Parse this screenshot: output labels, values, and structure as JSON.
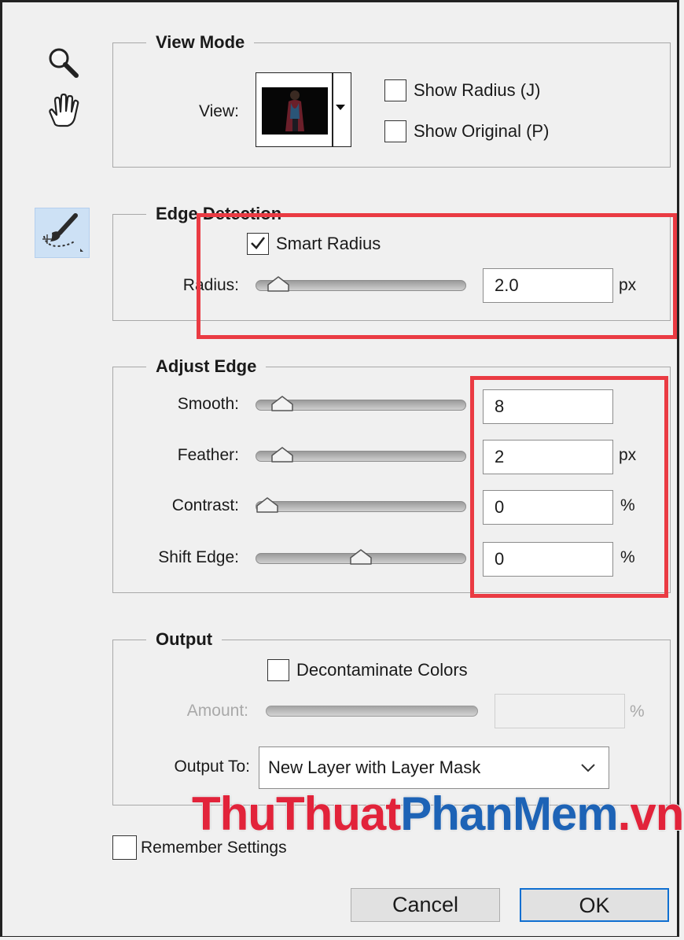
{
  "view_mode": {
    "title": "View Mode",
    "view_label": "View:",
    "show_radius": {
      "label": "Show Radius (J)",
      "checked": false
    },
    "show_original": {
      "label": "Show Original (P)",
      "checked": false
    }
  },
  "edge_detection": {
    "title": "Edge Detection",
    "smart_radius": {
      "label": "Smart Radius",
      "checked": true
    },
    "radius": {
      "label": "Radius:",
      "value": "2.0",
      "unit": "px",
      "slider_fraction": 0.06
    }
  },
  "adjust_edge": {
    "title": "Adjust Edge",
    "smooth": {
      "label": "Smooth:",
      "value": "8",
      "unit": "",
      "slider_fraction": 0.08
    },
    "feather": {
      "label": "Feather:",
      "value": "2",
      "unit": "px",
      "slider_fraction": 0.08
    },
    "contrast": {
      "label": "Contrast:",
      "value": "0",
      "unit": "%",
      "slider_fraction": 0.0
    },
    "shift_edge": {
      "label": "Shift Edge:",
      "value": "0",
      "unit": "%",
      "slider_fraction": 0.5
    }
  },
  "output": {
    "title": "Output",
    "decontaminate": {
      "label": "Decontaminate Colors",
      "checked": false
    },
    "amount": {
      "label": "Amount:",
      "value": "",
      "unit": "%"
    },
    "output_to_label": "Output To:",
    "output_to_value": "New Layer with Layer Mask"
  },
  "remember_settings": {
    "label": "Remember Settings",
    "checked": false
  },
  "buttons": {
    "cancel": "Cancel",
    "ok": "OK"
  },
  "watermark": {
    "part1": "ThuThuat",
    "part2": "PhanMem",
    "part3": ".vn"
  },
  "colors": {
    "highlight": "#ea3b43",
    "ok_border": "#0f6fd1",
    "watermark_red": "#e2233a",
    "watermark_blue": "#1d63b6"
  },
  "icons": [
    "zoom-icon",
    "hand-icon",
    "refine-radius-brush-icon",
    "checkmark-icon",
    "dropdown-arrow-icon",
    "chevron-down-icon"
  ]
}
